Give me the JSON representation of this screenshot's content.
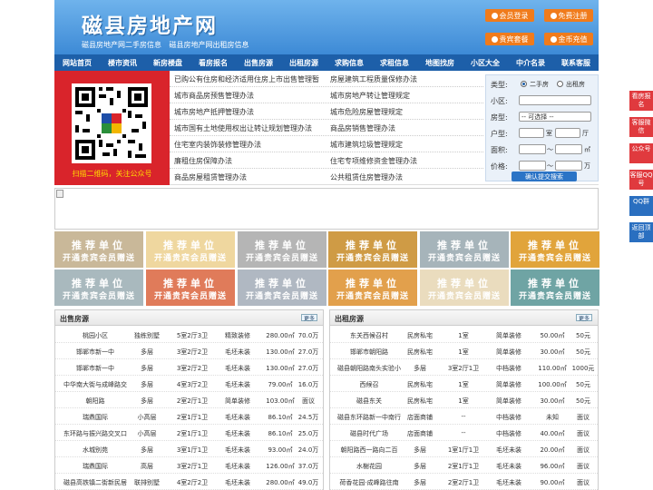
{
  "header": {
    "site_name": "磁县房地产网",
    "slogans": [
      "磁县房地产网二手房信息",
      "磁县房地产网出租房信息"
    ],
    "buttons": [
      "会员登录",
      "免费注册",
      "贵宾套餐",
      "金币充值"
    ]
  },
  "nav": [
    "网站首页",
    "楼市资讯",
    "新房楼盘",
    "看房报名",
    "出售房源",
    "出租房源",
    "求购信息",
    "求租信息",
    "地图找房",
    "小区大全",
    "中介名录",
    "联系客服"
  ],
  "qr": {
    "caption": "扫描二维码，关注公众号"
  },
  "news": {
    "left": [
      "已购公有住房和经济适用住房上市出售管理暂",
      "城市商品房预售管理办法",
      "城市房地产抵押管理办法",
      "城市国有土地使用权出让转让规划管理办法",
      "住宅室内装饰装修管理办法",
      "廉租住房保障办法",
      "商品房屋租赁管理办法"
    ],
    "right": [
      "房屋建筑工程质量保修办法",
      "城市房地产转让管理规定",
      "城市危险房屋管理规定",
      "商品房销售管理办法",
      "城市建筑垃圾管理规定",
      "住宅专项维修资金管理办法",
      "公共租赁住房管理办法"
    ]
  },
  "search": {
    "type_label": "类型:",
    "type_options": [
      "二手房",
      "出租房"
    ],
    "community_label": "小区:",
    "house_type_label": "房型:",
    "house_type_value": "-- 可选择 --",
    "layout_label": "户型:",
    "room_unit": "室",
    "hall_unit": "厅",
    "area_label": "面积:",
    "area_unit": "㎡",
    "price_label": "价格:",
    "price_unit": "万",
    "range_sep": "～",
    "submit": "确认提交搜索"
  },
  "tiles": {
    "line1": "推荐单位",
    "line2": "开通贵宾会员赠送",
    "colors": [
      "#c9b899",
      "#efd79f",
      "#b5b5b5",
      "#cf9b45",
      "#a6b4ba",
      "#e1a43b",
      "#a9b9be",
      "#e07b5a",
      "#b0b8c2",
      "#e2a04c",
      "#eadcbe",
      "#6fa4a4"
    ]
  },
  "sale": {
    "title": "出售房源",
    "more": "更多",
    "rows": [
      [
        "桃园小区",
        "独栋别墅",
        "5室2厅3卫",
        "精致装修",
        "280.00㎡",
        "70.0万"
      ],
      [
        "邯郸市新一中",
        "多层",
        "3室2厅2卫",
        "毛坯未装",
        "130.00㎡",
        "27.0万"
      ],
      [
        "邯郸市新一中",
        "多层",
        "3室2厅2卫",
        "毛坯未装",
        "130.00㎡",
        "27.0万"
      ],
      [
        "中华南大街与成峰路交",
        "多层",
        "4室3厅2卫",
        "毛坯未装",
        "79.00㎡",
        "16.0万"
      ],
      [
        "朝阳路",
        "多层",
        "2室2厅1卫",
        "简单装修",
        "103.00㎡",
        "面议"
      ],
      [
        "瑞鼎国际",
        "小高层",
        "2室1厅1卫",
        "毛坯未装",
        "86.10㎡",
        "24.5万"
      ],
      [
        "东环路与振兴路交叉口",
        "小高层",
        "2室1厅1卫",
        "毛坯未装",
        "86.10㎡",
        "25.0万"
      ],
      [
        "水城别苑",
        "多层",
        "3室1厅1卫",
        "毛坯未装",
        "93.00㎡",
        "24.0万"
      ],
      [
        "瑞鼎国际",
        "高层",
        "3室2厅1卫",
        "毛坯未装",
        "126.00㎡",
        "37.0万"
      ],
      [
        "磁县高铁镇二街新民居",
        "联排别墅",
        "4室2厅2卫",
        "毛坯未装",
        "280.00㎡",
        "49.0万"
      ]
    ]
  },
  "rent": {
    "title": "出租房源",
    "more": "更多",
    "rows": [
      [
        "东关西候召村",
        "民房私宅",
        "1室",
        "简单装修",
        "50.00㎡",
        "50元"
      ],
      [
        "邯郸市朝阳路",
        "民房私宅",
        "1室",
        "简单装修",
        "30.00㎡",
        "50元"
      ],
      [
        "磁县朝阳路南头实验小",
        "多层",
        "3室2厅1卫",
        "中档装修",
        "110.00㎡",
        "1000元"
      ],
      [
        "西候召",
        "民房私宅",
        "1室",
        "简单装修",
        "100.00㎡",
        "50元"
      ],
      [
        "磁县东关",
        "民房私宅",
        "1室",
        "简单装修",
        "30.00㎡",
        "50元"
      ],
      [
        "磁县东环路新一中南行",
        "店面商铺",
        "--",
        "中档装修",
        "未知",
        "面议"
      ],
      [
        "磁县时代广场",
        "店面商铺",
        "--",
        "中档装修",
        "40.00㎡",
        "面议"
      ],
      [
        "朝阳路西一路向二百",
        "多层",
        "1室1厅1卫",
        "毛坯未装",
        "20.00㎡",
        "面议"
      ],
      [
        "水榭花园",
        "多层",
        "2室1厅1卫",
        "毛坯未装",
        "96.00㎡",
        "面议"
      ],
      [
        "荷香花园·成峰路往南",
        "多层",
        "2室2厅1卫",
        "毛坯未装",
        "90.00㎡",
        "面议"
      ]
    ]
  },
  "side_buttons": [
    "看房报名",
    "客服微信",
    "公众号",
    "客服QQ号",
    "QQ群",
    "返回顶部"
  ]
}
